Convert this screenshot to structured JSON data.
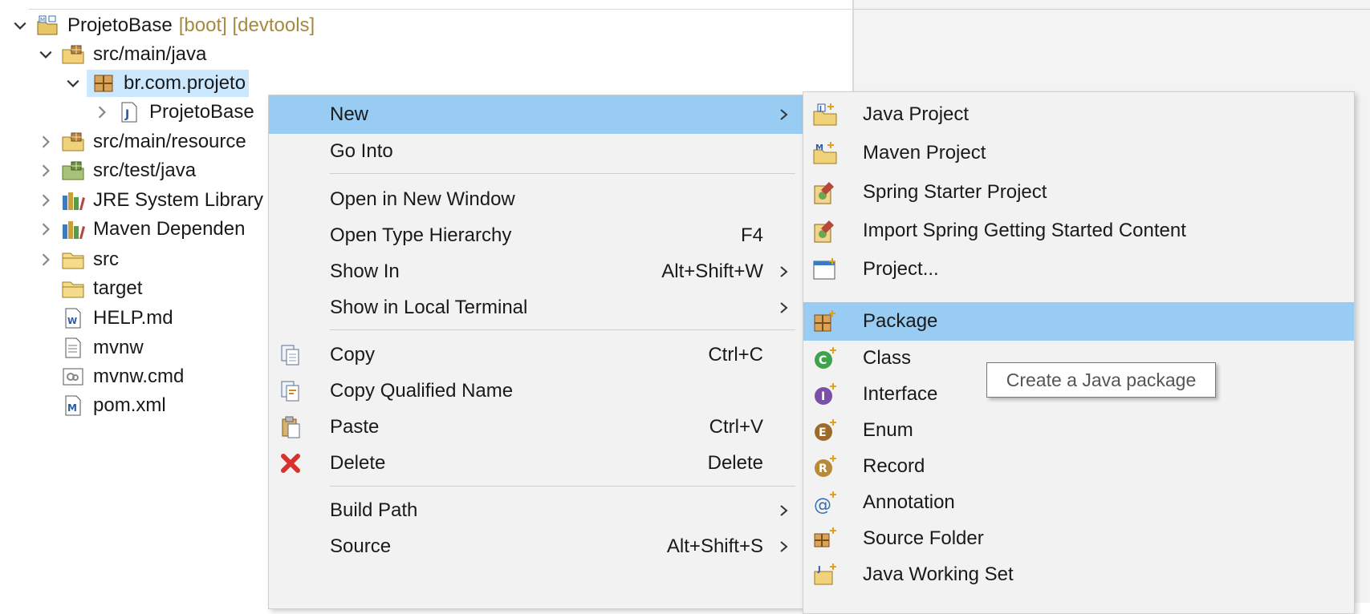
{
  "tree": {
    "items": [
      {
        "label": "ProjetoBase",
        "suffix": "[boot] [devtools]",
        "icon": "spring-project-icon",
        "expanded": true
      },
      {
        "label": "src/main/java",
        "icon": "source-folder-icon",
        "expanded": true
      },
      {
        "label": "br.com.projeto",
        "icon": "package-icon",
        "expanded": true,
        "selected": true
      },
      {
        "label": "ProjetoBase",
        "icon": "java-file-icon",
        "expanded": false
      },
      {
        "label": "src/main/resource",
        "icon": "source-folder-icon",
        "expanded": false
      },
      {
        "label": "src/test/java",
        "icon": "source-folder-icon",
        "expanded": false
      },
      {
        "label": "JRE System Library",
        "icon": "library-icon",
        "expanded": false
      },
      {
        "label": "Maven Dependen",
        "icon": "library-icon",
        "expanded": false
      },
      {
        "label": "src",
        "icon": "folder-icon",
        "expanded": false
      },
      {
        "label": "target",
        "icon": "folder-icon"
      },
      {
        "label": "HELP.md",
        "icon": "markdown-file-icon"
      },
      {
        "label": "mvnw",
        "icon": "text-file-icon"
      },
      {
        "label": "mvnw.cmd",
        "icon": "cmd-file-icon"
      },
      {
        "label": "pom.xml",
        "icon": "maven-pom-icon"
      }
    ]
  },
  "context_menu": {
    "items": [
      {
        "label": "New",
        "accelerator": "",
        "submenu": true,
        "highlighted": true
      },
      {
        "label": "Go Into",
        "accelerator": ""
      },
      {
        "label": "Open in New Window",
        "accelerator": ""
      },
      {
        "label": "Open Type Hierarchy",
        "accelerator": "F4"
      },
      {
        "label": "Show In",
        "accelerator": "Alt+Shift+W",
        "submenu": true
      },
      {
        "label": "Show in Local Terminal",
        "accelerator": "",
        "submenu": true
      },
      {
        "label": "Copy",
        "accelerator": "Ctrl+C",
        "icon": "copy-icon"
      },
      {
        "label": "Copy Qualified Name",
        "accelerator": "",
        "icon": "copy-qualified-name-icon"
      },
      {
        "label": "Paste",
        "accelerator": "Ctrl+V",
        "icon": "paste-icon"
      },
      {
        "label": "Delete",
        "accelerator": "Delete",
        "icon": "delete-icon"
      },
      {
        "label": "Build Path",
        "accelerator": "",
        "submenu": true
      },
      {
        "label": "Source",
        "accelerator": "Alt+Shift+S",
        "submenu": true
      }
    ]
  },
  "new_submenu": {
    "items": [
      {
        "label": "Java Project",
        "icon": "java-project-icon"
      },
      {
        "label": "Maven Project",
        "icon": "maven-project-icon"
      },
      {
        "label": "Spring Starter Project",
        "icon": "spring-starter-icon"
      },
      {
        "label": "Import Spring Getting Started Content",
        "icon": "spring-import-icon"
      },
      {
        "label": "Project...",
        "icon": "project-icon"
      },
      {
        "label": "Package",
        "icon": "new-package-icon",
        "highlighted": true
      },
      {
        "label": "Class",
        "icon": "class-icon"
      },
      {
        "label": "Interface",
        "icon": "interface-icon"
      },
      {
        "label": "Enum",
        "icon": "enum-icon"
      },
      {
        "label": "Record",
        "icon": "record-icon"
      },
      {
        "label": "Annotation",
        "icon": "annotation-icon"
      },
      {
        "label": "Source Folder",
        "icon": "new-source-folder-icon"
      },
      {
        "label": "Java Working Set",
        "icon": "working-set-icon"
      }
    ]
  },
  "tooltip": {
    "text": "Create a Java package"
  },
  "colors": {
    "highlight": "#99ccf3",
    "tree_selection": "#cce8ff",
    "menu_background": "#f2f2f2",
    "decoration_text": "#a6893e"
  }
}
